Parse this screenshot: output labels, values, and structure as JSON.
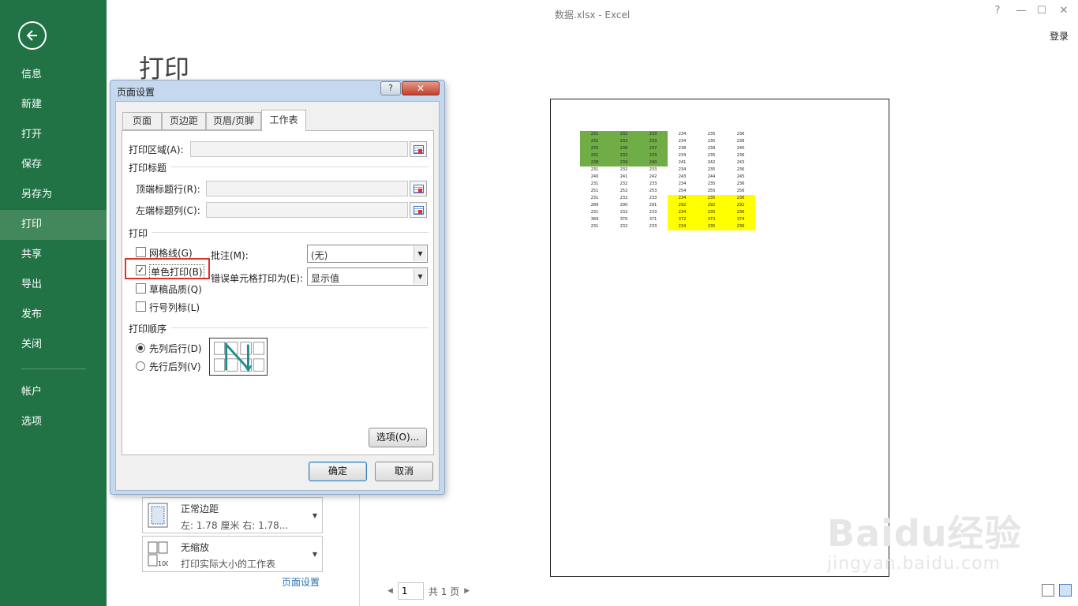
{
  "window": {
    "title": "数据.xlsx - Excel",
    "help": "?",
    "minimize": "—",
    "restore": "☐",
    "close": "✕",
    "sign_in": "登录"
  },
  "nav": {
    "back_icon": "back-arrow-icon",
    "items": [
      "信息",
      "新建",
      "打开",
      "保存",
      "另存为",
      "打印",
      "共享",
      "导出",
      "发布",
      "关闭"
    ],
    "active": "打印",
    "bottom_items": [
      "帐户",
      "选项"
    ]
  },
  "page_heading": "打印",
  "print_settings": {
    "margins_title": "正常边距",
    "margins_detail": "左: 1.78 厘米    右: 1.78...",
    "scaling_title": "无缩放",
    "scaling_detail": "打印实际大小的工作表",
    "page_setup_link": "页面设置"
  },
  "pager": {
    "current_page": "1",
    "total": "共 1 页"
  },
  "watermark": {
    "line1": "Baidu经验",
    "line2": "jingyan.baidu.com"
  },
  "dialog": {
    "title": "页面设置",
    "help_label": "?",
    "close_label": "✕",
    "tabs": [
      "页面",
      "页边距",
      "页眉/页脚",
      "工作表"
    ],
    "active_tab": "工作表",
    "print_area_label": "打印区域(A):",
    "print_titles_group": "打印标题",
    "rows_to_repeat_label": "顶端标题行(R):",
    "cols_to_repeat_label": "左端标题列(C):",
    "print_group": "打印",
    "gridlines_label": "网格线(G)",
    "gridlines_checked": false,
    "bw_label": "单色打印(B)",
    "bw_checked": true,
    "draft_label": "草稿品质(Q)",
    "draft_checked": false,
    "headings_label": "行号列标(L)",
    "headings_checked": false,
    "comments_label": "批注(M):",
    "comments_value": "(无)",
    "errors_label": "错误单元格打印为(E):",
    "errors_value": "显示值",
    "order_group": "打印顺序",
    "down_then_over_label": "先列后行(D)",
    "over_then_down_label": "先行后列(V)",
    "order_selected": "先列后行(D)",
    "options_button": "选项(O)...",
    "ok_button": "确定",
    "cancel_button": "取消"
  },
  "preview": {
    "rows": [
      [
        {
          "v": "231",
          "c": "g"
        },
        {
          "v": "232",
          "c": "g"
        },
        {
          "v": "233",
          "c": "g"
        },
        {
          "v": "234"
        },
        {
          "v": "235"
        },
        {
          "v": "236"
        }
      ],
      [
        {
          "v": "231",
          "c": "g"
        },
        {
          "v": "232",
          "c": "g"
        },
        {
          "v": "233",
          "c": "g"
        },
        {
          "v": "234"
        },
        {
          "v": "235"
        },
        {
          "v": "236"
        }
      ],
      [
        {
          "v": "235",
          "c": "g"
        },
        {
          "v": "236",
          "c": "g"
        },
        {
          "v": "237",
          "c": "g"
        },
        {
          "v": "238"
        },
        {
          "v": "239"
        },
        {
          "v": "240"
        }
      ],
      [
        {
          "v": "231",
          "c": "g"
        },
        {
          "v": "232",
          "c": "g"
        },
        {
          "v": "233",
          "c": "g"
        },
        {
          "v": "234"
        },
        {
          "v": "235"
        },
        {
          "v": "236"
        }
      ],
      [
        {
          "v": "238",
          "c": "g"
        },
        {
          "v": "239",
          "c": "g"
        },
        {
          "v": "240",
          "c": "g"
        },
        {
          "v": "241"
        },
        {
          "v": "242"
        },
        {
          "v": "243"
        }
      ],
      [
        {
          "v": "231"
        },
        {
          "v": "232"
        },
        {
          "v": "233"
        },
        {
          "v": "234"
        },
        {
          "v": "235"
        },
        {
          "v": "236"
        }
      ],
      [
        {
          "v": "240"
        },
        {
          "v": "241"
        },
        {
          "v": "242"
        },
        {
          "v": "243"
        },
        {
          "v": "244"
        },
        {
          "v": "245"
        }
      ],
      [
        {
          "v": "231"
        },
        {
          "v": "232"
        },
        {
          "v": "233"
        },
        {
          "v": "234"
        },
        {
          "v": "235"
        },
        {
          "v": "236"
        }
      ],
      [
        {
          "v": "251"
        },
        {
          "v": "252"
        },
        {
          "v": "253"
        },
        {
          "v": "254"
        },
        {
          "v": "255"
        },
        {
          "v": "256"
        }
      ],
      [
        {
          "v": "231"
        },
        {
          "v": "232"
        },
        {
          "v": "233"
        },
        {
          "v": "234",
          "c": "y"
        },
        {
          "v": "235",
          "c": "y"
        },
        {
          "v": "236",
          "c": "y"
        }
      ],
      [
        {
          "v": "289"
        },
        {
          "v": "290"
        },
        {
          "v": "291"
        },
        {
          "v": "292",
          "c": "y"
        },
        {
          "v": "292",
          "c": "y"
        },
        {
          "v": "292",
          "c": "y"
        }
      ],
      [
        {
          "v": "231"
        },
        {
          "v": "232"
        },
        {
          "v": "233"
        },
        {
          "v": "234",
          "c": "y"
        },
        {
          "v": "235",
          "c": "y"
        },
        {
          "v": "236",
          "c": "y"
        }
      ],
      [
        {
          "v": "369"
        },
        {
          "v": "370"
        },
        {
          "v": "371"
        },
        {
          "v": "372",
          "c": "y"
        },
        {
          "v": "373",
          "c": "y"
        },
        {
          "v": "374",
          "c": "y"
        }
      ],
      [
        {
          "v": "231"
        },
        {
          "v": "232"
        },
        {
          "v": "233"
        },
        {
          "v": "234",
          "c": "y"
        },
        {
          "v": "235",
          "c": "y"
        },
        {
          "v": "236",
          "c": "y"
        }
      ]
    ]
  },
  "colors": {
    "nav_green": "#217346",
    "highlight_red": "#e0302a",
    "cell_green": "#70ad47",
    "cell_yellow": "#ffff00"
  }
}
